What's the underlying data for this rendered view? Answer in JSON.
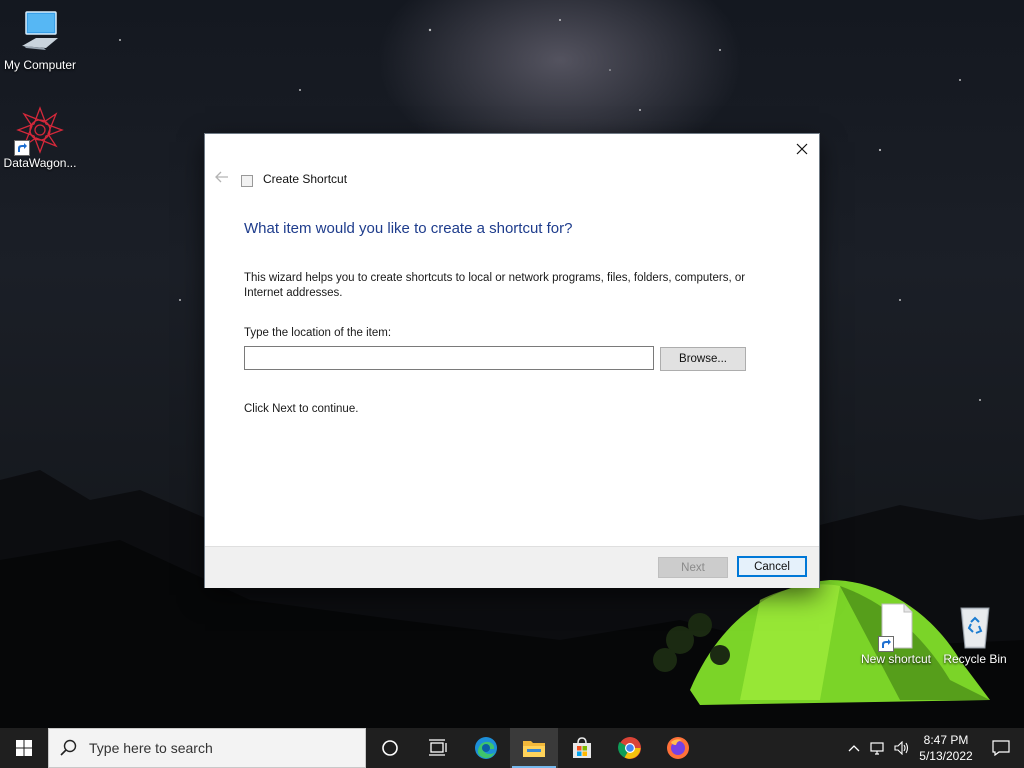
{
  "desktop": {
    "icons": [
      {
        "label": "My Computer"
      },
      {
        "label": "DataWagon..."
      },
      {
        "label": "New shortcut"
      },
      {
        "label": "Recycle Bin"
      }
    ]
  },
  "dialog": {
    "title": "Create Shortcut",
    "heading": "What item would you like to create a shortcut for?",
    "description": "This wizard helps you to create shortcuts to local or network programs, files, folders, computers, or Internet addresses.",
    "location_label": "Type the location of the item:",
    "location_value": "",
    "browse_label": "Browse...",
    "continue_text": "Click Next to continue.",
    "next_label": "Next",
    "cancel_label": "Cancel"
  },
  "taskbar": {
    "search_placeholder": "Type here to search",
    "pinned": [
      "cortana-icon",
      "task-view-icon",
      "edge-icon",
      "file-explorer-icon",
      "store-icon",
      "chrome-icon",
      "firefox-icon"
    ],
    "clock_time": "8:47 PM",
    "clock_date": "5/13/2022"
  },
  "colors": {
    "heading": "#1e3c8c",
    "taskbar": "#1f1f1f",
    "accent": "#0078d7"
  }
}
